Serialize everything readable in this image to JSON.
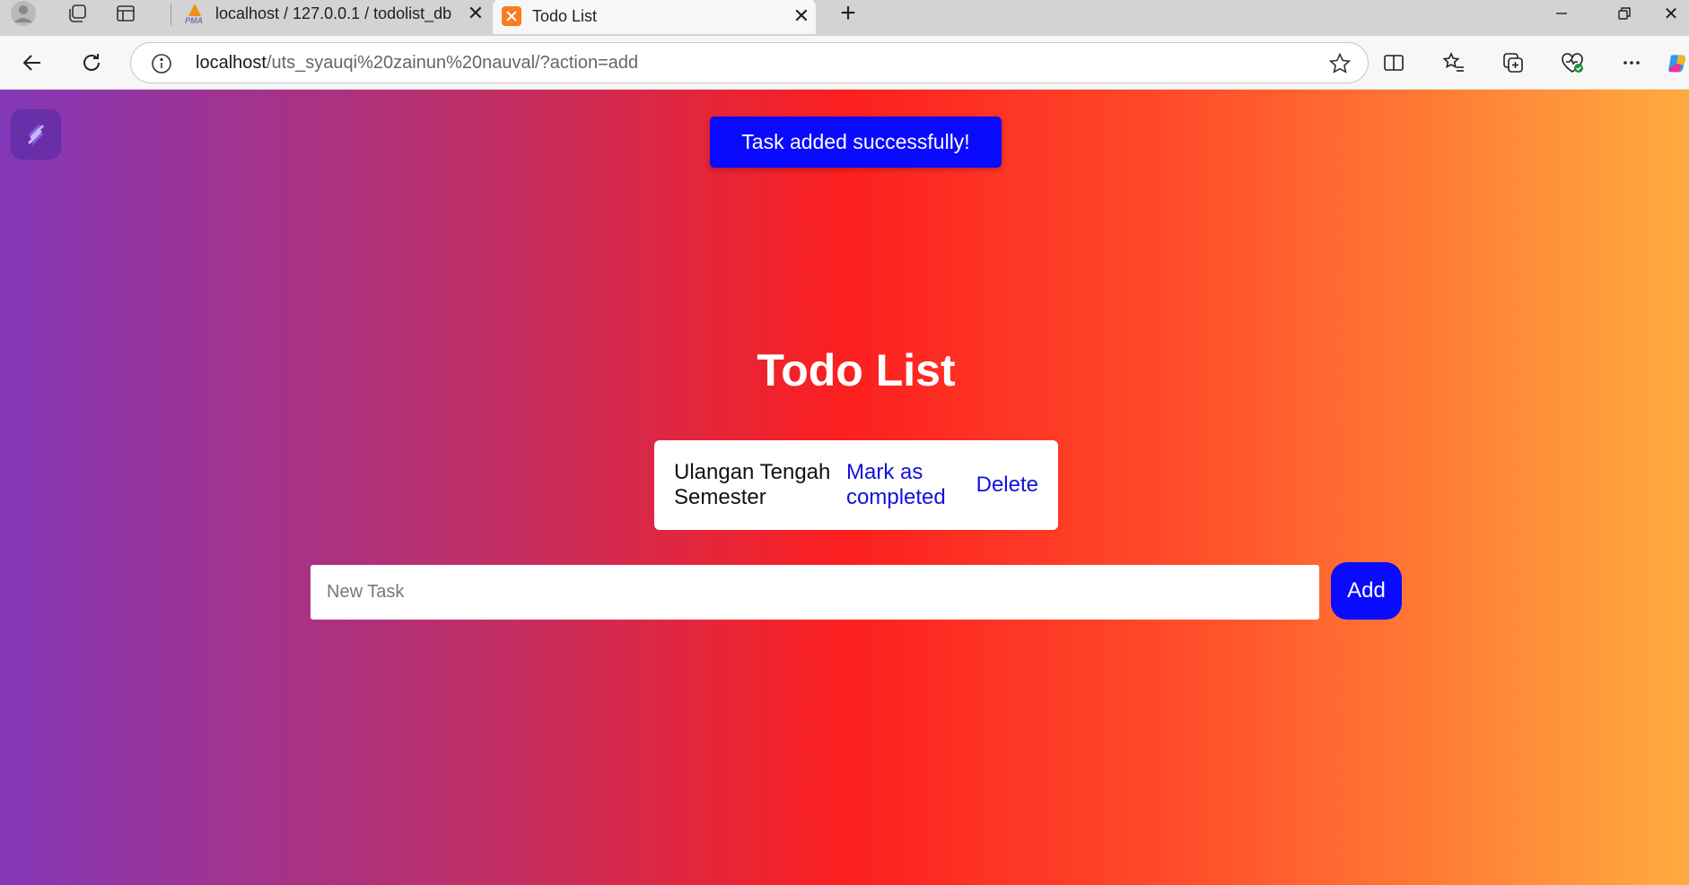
{
  "browser": {
    "tabs": [
      {
        "title": "localhost / 127.0.0.1 / todolist_db",
        "favicon": "phpmyadmin-icon",
        "active": false
      },
      {
        "title": "Todo List",
        "favicon": "xampp-icon",
        "active": true
      }
    ],
    "address": {
      "host": "localhost",
      "path": "/uts_syauqi%20zainun%20nauval/?action=add"
    }
  },
  "page": {
    "toast": "Task added successfully!",
    "title": "Todo List",
    "tasks": [
      {
        "text": "Ulangan Tengah Semester",
        "complete_label": "Mark as completed",
        "delete_label": "Delete"
      }
    ],
    "new_task": {
      "placeholder": "New Task",
      "value": ""
    },
    "add_label": "Add",
    "colors": {
      "accent": "#0a0aff",
      "gradient_start": "#8338b8",
      "gradient_mid": "#fc1f1f",
      "gradient_end": "#ffab40"
    }
  }
}
